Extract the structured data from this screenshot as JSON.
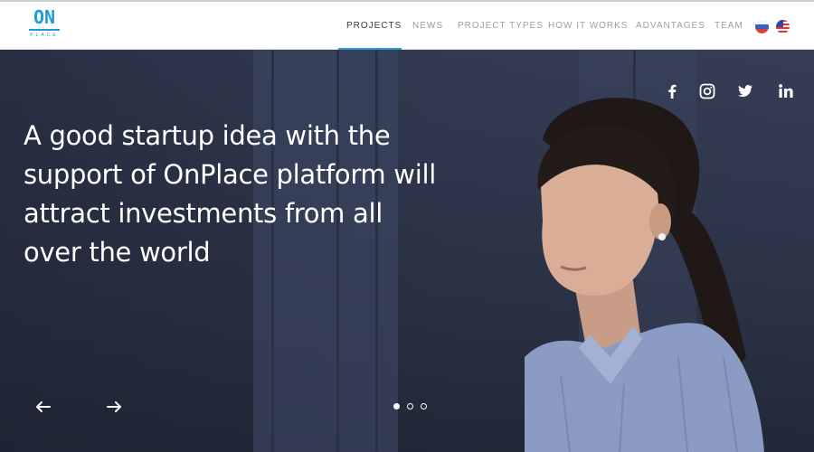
{
  "brand": {
    "logo_main": "ON",
    "logo_sub": "PLACE",
    "color": "#1d9bd8"
  },
  "nav": {
    "items": [
      {
        "label": "PROJECTS",
        "active": true
      },
      {
        "label": "NEWS",
        "active": false
      },
      {
        "label": "PROJECT TYPES",
        "active": false
      },
      {
        "label": "HOW IT WORKS",
        "active": false
      },
      {
        "label": "ADVANTAGES",
        "active": false
      },
      {
        "label": "TEAM",
        "active": false
      }
    ],
    "active_color": "#333a42",
    "inactive_color": "#9aa0a6",
    "underline_color": "#2a9fd8"
  },
  "languages": [
    {
      "icon": "flag-ru-icon"
    },
    {
      "icon": "flag-us-icon"
    }
  ],
  "hero": {
    "headline": "A good startup idea with the support of OnPlace platform will attract investments from all over the world",
    "social": [
      {
        "icon": "facebook-icon"
      },
      {
        "icon": "instagram-icon"
      },
      {
        "icon": "twitter-icon"
      },
      {
        "icon": "linkedin-icon"
      }
    ],
    "prev_icon": "arrow-left-icon",
    "next_icon": "arrow-right-icon",
    "slides": {
      "count": 3,
      "active": 1
    }
  }
}
